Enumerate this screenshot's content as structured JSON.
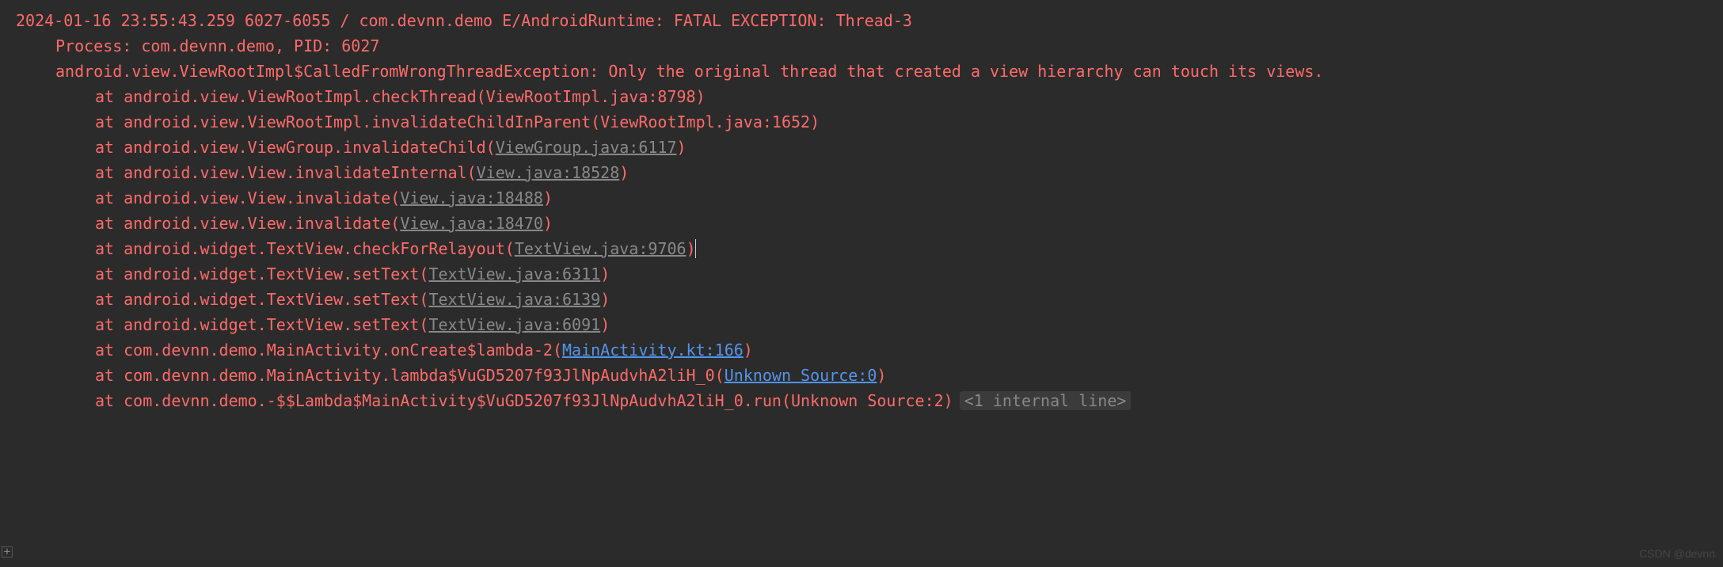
{
  "header": {
    "timestamp": "2024-01-16 23:55:43.259",
    "pid_tid": "6027-6055",
    "package": "com.devnn.demo",
    "tag": "E/AndroidRuntime:",
    "message": "FATAL EXCEPTION: Thread-3"
  },
  "process_line": "Process: com.devnn.demo, PID: 6027",
  "exception_line": "android.view.ViewRootImpl$CalledFromWrongThreadException: Only the original thread that created a view hierarchy can touch its views.",
  "stack": [
    {
      "prefix": "at android.view.ViewRootImpl.checkThread(ViewRootImpl.java:8798)",
      "link": null,
      "suffix": ""
    },
    {
      "prefix": "at android.view.ViewRootImpl.invalidateChildInParent(ViewRootImpl.java:1652)",
      "link": null,
      "suffix": ""
    },
    {
      "prefix": "at android.view.ViewGroup.invalidateChild(",
      "link": "ViewGroup.java:6117",
      "link_type": "gray",
      "suffix": ")"
    },
    {
      "prefix": "at android.view.View.invalidateInternal(",
      "link": "View.java:18528",
      "link_type": "gray",
      "suffix": ")"
    },
    {
      "prefix": "at android.view.View.invalidate(",
      "link": "View.java:18488",
      "link_type": "gray",
      "suffix": ")"
    },
    {
      "prefix": "at android.view.View.invalidate(",
      "link": "View.java:18470",
      "link_type": "gray",
      "suffix": ")"
    },
    {
      "prefix": "at android.widget.TextView.checkForRelayout(",
      "link": "TextView.java:9706",
      "link_type": "gray",
      "suffix": ")",
      "cursor": true
    },
    {
      "prefix": "at android.widget.TextView.setText(",
      "link": "TextView.java:6311",
      "link_type": "gray",
      "suffix": ")"
    },
    {
      "prefix": "at android.widget.TextView.setText(",
      "link": "TextView.java:6139",
      "link_type": "gray",
      "suffix": ")"
    },
    {
      "prefix": "at android.widget.TextView.setText(",
      "link": "TextView.java:6091",
      "link_type": "gray",
      "suffix": ")"
    },
    {
      "prefix": "at com.devnn.demo.MainActivity.onCreate$lambda-2(",
      "link": "MainActivity.kt:166",
      "link_type": "blue",
      "suffix": ")"
    },
    {
      "prefix": "at com.devnn.demo.MainActivity.lambda$VuGD5207f93JlNpAudvhA2liH_0(",
      "link": "Unknown Source:0",
      "link_type": "blue",
      "suffix": ")"
    },
    {
      "prefix": "at com.devnn.demo.-$$Lambda$MainActivity$VuGD5207f93JlNpAudvhA2liH_0.run(Unknown Source:2)",
      "link": null,
      "suffix": "",
      "fold": "<1 internal line>"
    }
  ],
  "expand_icon": "+",
  "watermark": "CSDN @devnn"
}
